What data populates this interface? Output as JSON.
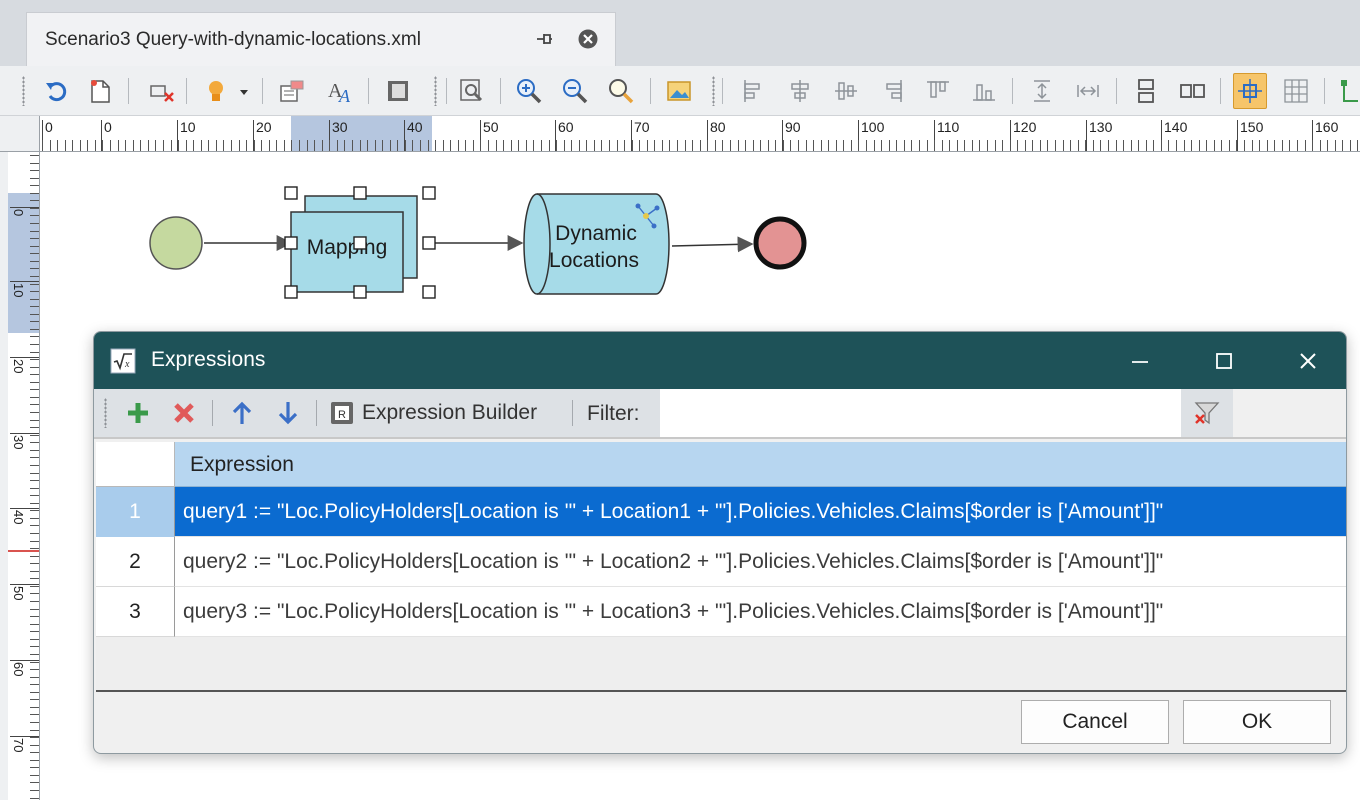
{
  "document_tab": {
    "title": "Scenario3 Query-with-dynamic-locations.xml",
    "pin_icon": "pin-icon",
    "close_icon": "close-circle-icon"
  },
  "toolbar": {
    "icons": [
      "undo-icon",
      "new-document-icon",
      "delete-connection-icon",
      "lightbulb-icon",
      "dropdown-arrow-icon",
      "properties-icon",
      "font-icon",
      "book-icon",
      "zoom-fit-icon",
      "zoom-in-icon",
      "zoom-out-icon",
      "zoom-icon",
      "picture-icon",
      "align-left-icon",
      "align-center-icon",
      "align-middle-icon",
      "align-right-icon",
      "align-top-icon",
      "align-bottom-icon",
      "space-vertical-icon",
      "space-horizontal-icon",
      "stack-vertical-icon",
      "stack-horizontal-icon",
      "snap-icon",
      "grid-icon",
      "connector-icon"
    ],
    "accent_color": "#f6c56a"
  },
  "ruler_h": {
    "labels": [
      "0",
      "0",
      "10",
      "20",
      "30",
      "40",
      "50",
      "60",
      "70",
      "80",
      "90",
      "100",
      "110",
      "120",
      "130",
      "140",
      "150",
      "160"
    ]
  },
  "ruler_v": {
    "labels": [
      "0",
      "10",
      "20",
      "30",
      "40",
      "50",
      "60",
      "70"
    ]
  },
  "diagram": {
    "nodes": {
      "start": {
        "label": ""
      },
      "mapping": {
        "label": "Mapping"
      },
      "dynamic_locations": {
        "label_line1": "Dynamic",
        "label_line2": "Locations"
      },
      "end": {
        "label": ""
      }
    },
    "colors": {
      "start_fill": "#c5d99f",
      "task_fill": "#a6dbe8",
      "end_fill": "#e39393"
    }
  },
  "dialog": {
    "title": "Expressions",
    "title_icon": "sqrt-x-icon",
    "titlebar_color": "#1e5258",
    "toolbar": {
      "add_icon": "plus-icon",
      "delete_icon": "x-icon",
      "up_icon": "arrow-up-icon",
      "down_icon": "arrow-down-icon",
      "expression_builder_label": "Expression Builder",
      "filter_label": "Filter:",
      "filter_value": "",
      "clear_filter_icon": "funnel-clear-icon"
    },
    "grid": {
      "column_header": "Expression",
      "rows": [
        {
          "num": "1",
          "expression": "query1 := \"Loc.PolicyHolders[Location is '\" + Location1 + \"'].Policies.Vehicles.Claims[$order is ['Amount']]\""
        },
        {
          "num": "2",
          "expression": "query2 := \"Loc.PolicyHolders[Location is '\" + Location2 + \"'].Policies.Vehicles.Claims[$order is ['Amount']]\""
        },
        {
          "num": "3",
          "expression": "query3 := \"Loc.PolicyHolders[Location is '\" + Location3 + \"'].Policies.Vehicles.Claims[$order is ['Amount']]\""
        }
      ],
      "selected_color": "#0b6bd0"
    },
    "buttons": {
      "cancel": "Cancel",
      "ok": "OK"
    }
  }
}
